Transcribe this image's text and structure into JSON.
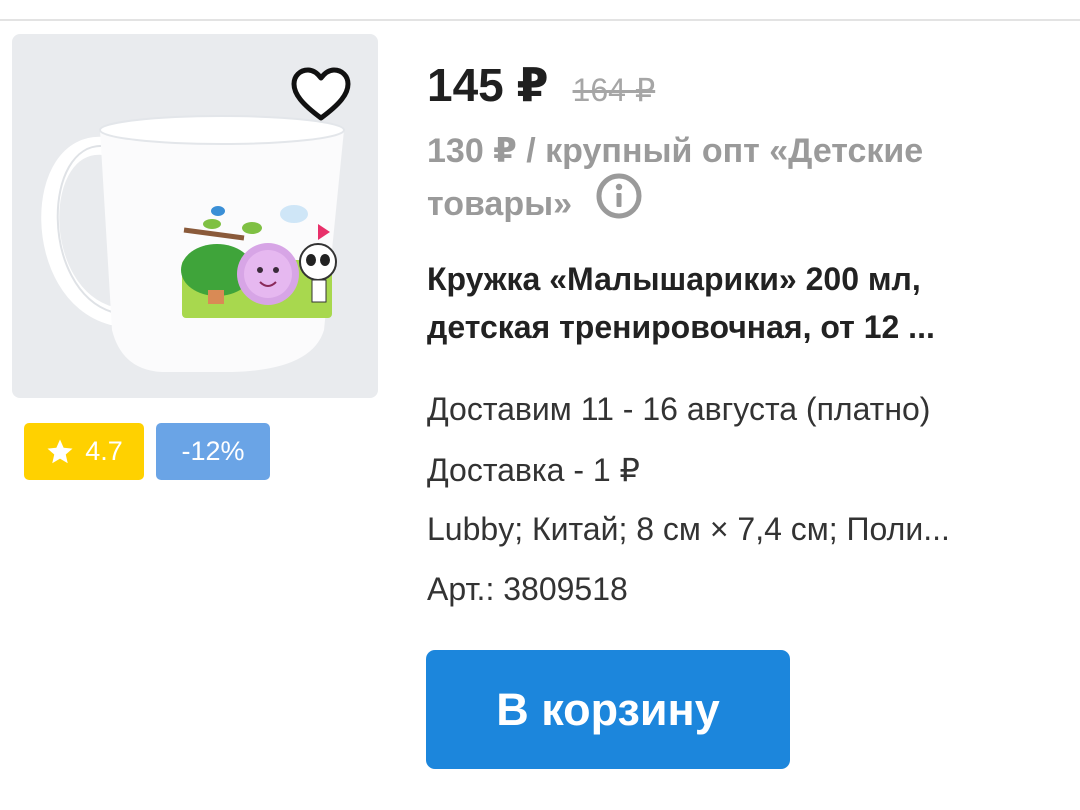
{
  "product": {
    "price_current": "145 ₽",
    "price_old": "164 ₽",
    "wholesale_text": "130 ₽ / крупный опт «Детские товары»",
    "title": "Кружка «Малышарики» 200 мл, детская тренировочная, от 12 ...",
    "delivery_dates": "Доставим 11 - 16 августа (платно)",
    "delivery_cost": "Доставка - 1 ₽",
    "specs": "Lubby; Китай; 8 см × 7,4 см; Поли...",
    "article": "Арт.: 3809518"
  },
  "badges": {
    "rating": "4.7",
    "discount": "-12%"
  },
  "actions": {
    "cart_label": "В корзину"
  },
  "icons": {
    "favorite": "heart-outline-icon",
    "info": "info-icon",
    "rating": "star-icon"
  },
  "colors": {
    "accent": "#1c86dc",
    "rating_badge": "#ffd100",
    "discount_badge": "#6aa4e6",
    "muted_text": "#9a9a9a"
  }
}
